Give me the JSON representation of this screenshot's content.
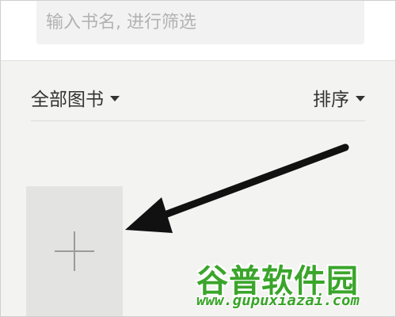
{
  "search": {
    "placeholder": "输入书名, 进行筛选",
    "value": ""
  },
  "filter": {
    "category_label": "全部图书",
    "sort_label": "排序"
  },
  "library": {
    "add_icon": "plus-icon"
  },
  "watermark": {
    "title": "谷普软件园",
    "url": "www.gupuxiazai.com"
  },
  "colors": {
    "background": "#f3f3f1",
    "add_tile": "#e3e3e1",
    "annotation_arrow": "#111111",
    "watermark_green": "#3aa52a"
  }
}
